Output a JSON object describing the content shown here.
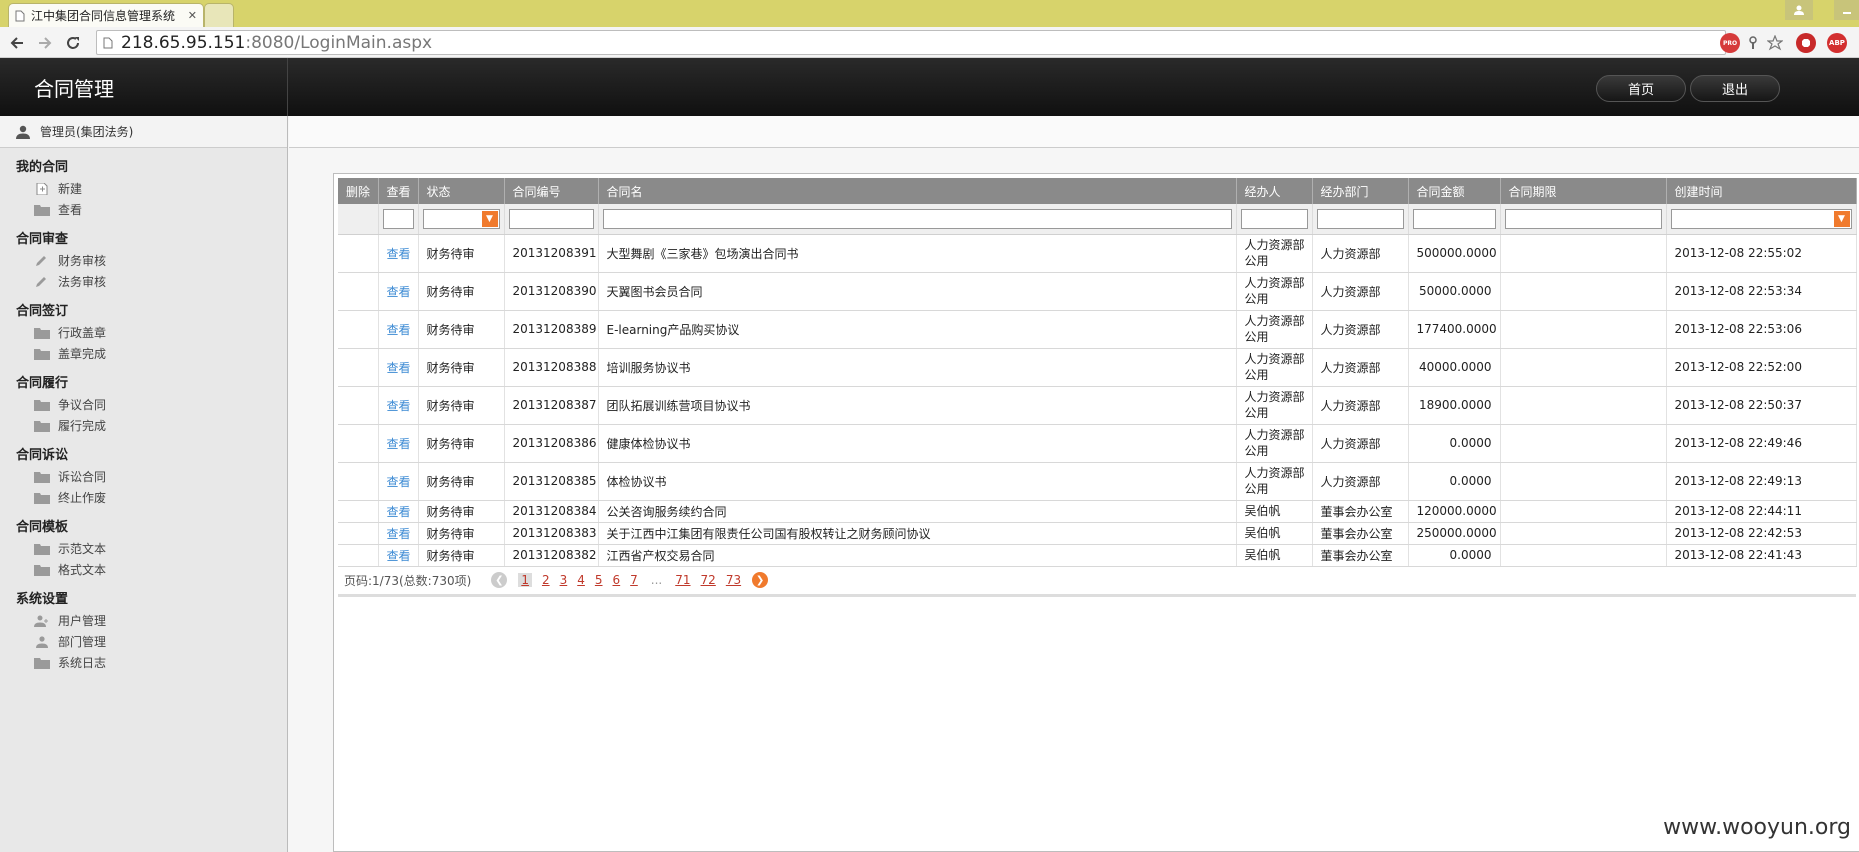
{
  "browser": {
    "tab_title": "江中集团合同信息管理系统",
    "close_glyph": "✕",
    "url_host": "218.65.95.151",
    "url_rest": ":8080/LoginMain.aspx",
    "ext_pro": "PRO",
    "ext_abp": "ABP"
  },
  "app": {
    "title": "合同管理",
    "home_label": "首页",
    "logout_label": "退出",
    "user_label": "管理员(集团法务)"
  },
  "sidebar": {
    "groups": [
      {
        "title": "我的合同",
        "items": [
          "新建",
          "查看"
        ]
      },
      {
        "title": "合同审查",
        "items": [
          "财务审核",
          "法务审核"
        ]
      },
      {
        "title": "合同签订",
        "items": [
          "行政盖章",
          "盖章完成"
        ]
      },
      {
        "title": "合同履行",
        "items": [
          "争议合同",
          "履行完成"
        ]
      },
      {
        "title": "合同诉讼",
        "items": [
          "诉讼合同",
          "终止作废"
        ]
      },
      {
        "title": "合同模板",
        "items": [
          "示范文本",
          "格式文本"
        ]
      },
      {
        "title": "系统设置",
        "items": [
          "用户管理",
          "部门管理",
          "系统日志"
        ]
      }
    ]
  },
  "grid": {
    "columns": [
      "删除",
      "查看",
      "状态",
      "合同编号",
      "合同名",
      "经办人",
      "经办部门",
      "合同金额",
      "合同期限",
      "创建时间"
    ],
    "rows": [
      {
        "view": "查看",
        "status": "财务待审",
        "code": "20131208391",
        "name": "大型舞剧《三家巷》包场演出合同书",
        "handler": "人力资源部公用",
        "dept": "人力资源部",
        "amount": "500000.0000",
        "term": "",
        "created": "2013-12-08 22:55:02"
      },
      {
        "view": "查看",
        "status": "财务待审",
        "code": "20131208390",
        "name": "天翼图书会员合同",
        "handler": "人力资源部公用",
        "dept": "人力资源部",
        "amount": "50000.0000",
        "term": "",
        "created": "2013-12-08 22:53:34"
      },
      {
        "view": "查看",
        "status": "财务待审",
        "code": "20131208389",
        "name": "E-learning产品购买协议",
        "handler": "人力资源部公用",
        "dept": "人力资源部",
        "amount": "177400.0000",
        "term": "",
        "created": "2013-12-08 22:53:06"
      },
      {
        "view": "查看",
        "status": "财务待审",
        "code": "20131208388",
        "name": "培训服务协议书",
        "handler": "人力资源部公用",
        "dept": "人力资源部",
        "amount": "40000.0000",
        "term": "",
        "created": "2013-12-08 22:52:00"
      },
      {
        "view": "查看",
        "status": "财务待审",
        "code": "20131208387",
        "name": "团队拓展训练营项目协议书",
        "handler": "人力资源部公用",
        "dept": "人力资源部",
        "amount": "18900.0000",
        "term": "",
        "created": "2013-12-08 22:50:37"
      },
      {
        "view": "查看",
        "status": "财务待审",
        "code": "20131208386",
        "name": "健康体检协议书",
        "handler": "人力资源部公用",
        "dept": "人力资源部",
        "amount": "0.0000",
        "term": "",
        "created": "2013-12-08 22:49:46"
      },
      {
        "view": "查看",
        "status": "财务待审",
        "code": "20131208385",
        "name": "体检协议书",
        "handler": "人力资源部公用",
        "dept": "人力资源部",
        "amount": "0.0000",
        "term": "",
        "created": "2013-12-08 22:49:13"
      },
      {
        "view": "查看",
        "status": "财务待审",
        "code": "20131208384",
        "name": "公关咨询服务续约合同",
        "handler": "吴伯帆",
        "dept": "董事会办公室",
        "amount": "120000.0000",
        "term": "",
        "created": "2013-12-08 22:44:11"
      },
      {
        "view": "查看",
        "status": "财务待审",
        "code": "20131208383",
        "name": "关于江西中江集团有限责任公司国有股权转让之财务顾问协议",
        "handler": "吴伯帆",
        "dept": "董事会办公室",
        "amount": "250000.0000",
        "term": "",
        "created": "2013-12-08 22:42:53"
      },
      {
        "view": "查看",
        "status": "财务待审",
        "code": "20131208382",
        "name": "江西省产权交易合同",
        "handler": "吴伯帆",
        "dept": "董事会办公室",
        "amount": "0.0000",
        "term": "",
        "created": "2013-12-08 22:41:43"
      }
    ]
  },
  "pager": {
    "info": "页码:1/73(总数:730项)",
    "pages": [
      "1",
      "2",
      "3",
      "4",
      "5",
      "6",
      "7"
    ],
    "ellipsis": "...",
    "last_pages": [
      "71",
      "72",
      "73"
    ]
  },
  "watermark": "www.wooyun.org",
  "colors": {
    "accent": "#f07a2d",
    "link": "#3d8bd4",
    "header_bg": "#1a1a1a"
  }
}
